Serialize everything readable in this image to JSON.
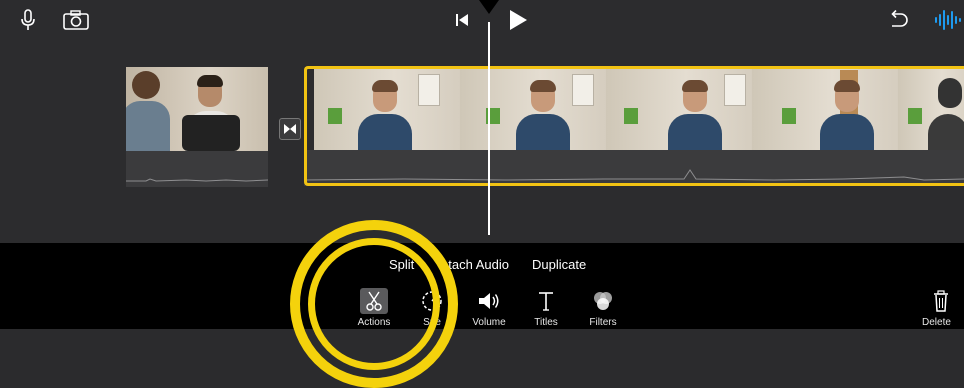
{
  "top_bar": {
    "left_icons": [
      "microphone-icon",
      "camera-icon"
    ],
    "center_icons": [
      "skip-to-start-icon",
      "play-icon"
    ],
    "right_icons": [
      "undo-icon",
      "audio-waveform-icon"
    ]
  },
  "timeline": {
    "clips": [
      {
        "name": "clip-1",
        "description_icon": "video-thumbnail"
      },
      {
        "name": "clip-2-selected",
        "description_icon": "video-thumbnail"
      }
    ],
    "transition_icon": "transition-icon",
    "colors": {
      "selection": "#f2c313",
      "background": "#2c2c2e"
    }
  },
  "actions_menu": {
    "split": "Split",
    "detach_audio": "etach Audio",
    "duplicate": "Duplicate"
  },
  "toolbar": {
    "actions": "Actions",
    "speed": "Spe",
    "volume": "Volume",
    "titles": "Titles",
    "filters": "Filters",
    "delete": "Delete"
  },
  "highlight": {
    "color": "#f4d20c"
  }
}
